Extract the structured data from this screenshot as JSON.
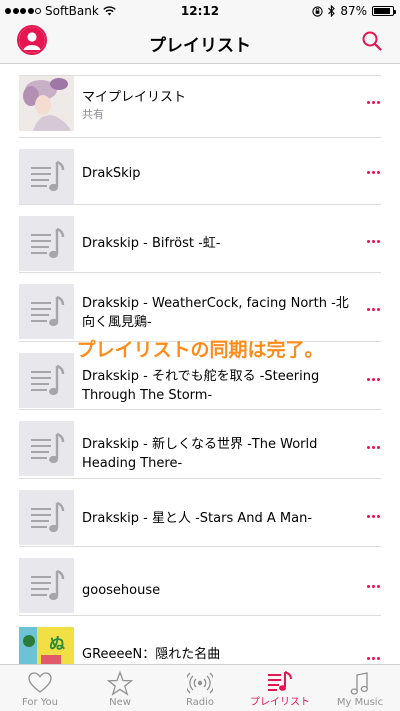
{
  "status_bar": {
    "carrier": "SoftBank",
    "time": "12:12",
    "battery": "87%",
    "battery_level": 0.87
  },
  "nav": {
    "title": "プレイリスト",
    "left_icon": "person-icon",
    "right_icon": "search-icon"
  },
  "accent_color": "#e4154f",
  "banner": {
    "text": "プレイリストの同期は完了。",
    "color": "#ff8c1a"
  },
  "playlists": [
    {
      "title": "マイプレイリスト",
      "subtitle": "共有",
      "artwork": "custom-photo"
    },
    {
      "title": "DrakSkip",
      "artwork": "music-note-placeholder"
    },
    {
      "title": "Drakskip - Bifröst -虹-",
      "artwork": "music-note-placeholder"
    },
    {
      "title": "Drakskip - WeatherCock, facing North -北向く風見鶏-",
      "artwork": "music-note-placeholder"
    },
    {
      "title": "Drakskip - それでも舵を取る -Steering Through The Storm-",
      "artwork": "music-note-placeholder"
    },
    {
      "title": "Drakskip - 新しくなる世界 -The World Heading There-",
      "artwork": "music-note-placeholder"
    },
    {
      "title": "Drakskip - 星と人 -Stars And A Man-",
      "artwork": "music-note-placeholder"
    },
    {
      "title": "goosehouse",
      "artwork": "music-note-placeholder"
    },
    {
      "title": "GReeeeN：隠れた名曲",
      "artwork": "album-photo"
    }
  ],
  "tabs": [
    {
      "label": "For You",
      "icon": "heart-icon",
      "active": false
    },
    {
      "label": "New",
      "icon": "star-icon",
      "active": false
    },
    {
      "label": "Radio",
      "icon": "radio-icon",
      "active": false
    },
    {
      "label": "プレイリスト",
      "icon": "playlist-icon",
      "active": true
    },
    {
      "label": "My Music",
      "icon": "music-note-icon",
      "active": false
    }
  ]
}
